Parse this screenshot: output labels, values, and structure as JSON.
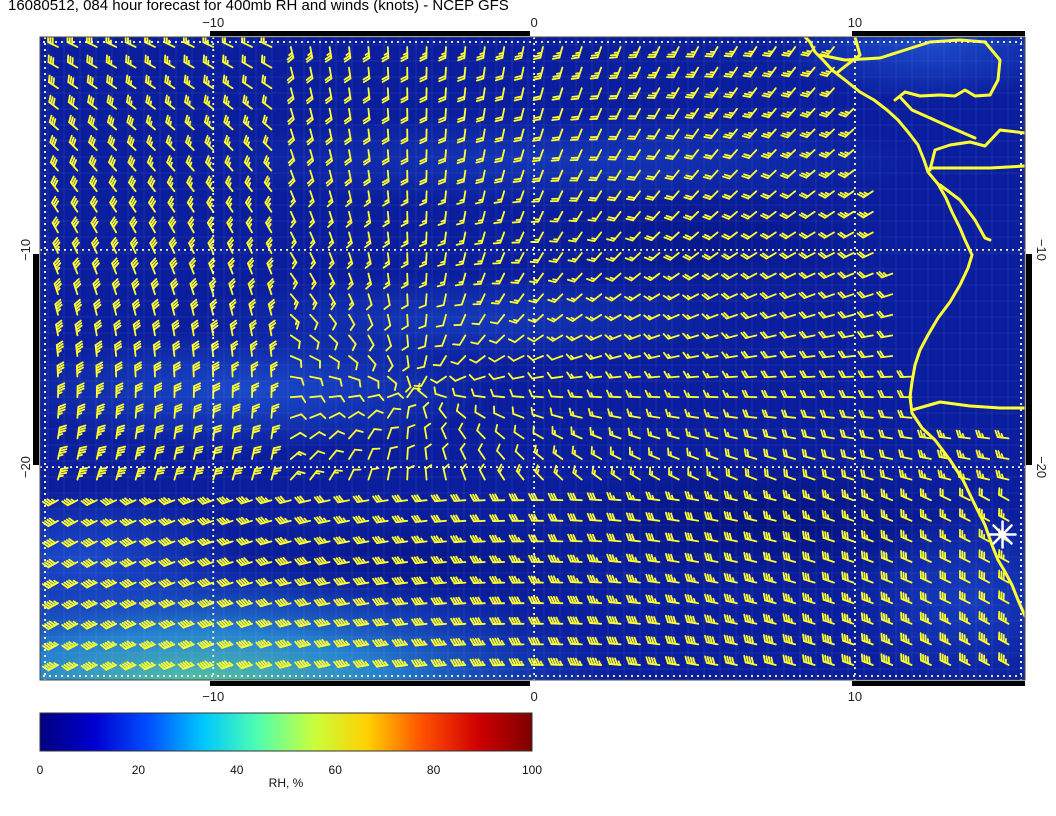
{
  "title": "16080512, 084 hour forecast for 400mb RH and winds (knots) - NCEP GFS",
  "axes": {
    "lon_ticks": [
      {
        "value": -10,
        "label": "−10"
      },
      {
        "value": 0,
        "label": "0"
      },
      {
        "value": 10,
        "label": "10"
      }
    ],
    "lat_ticks": [
      {
        "value": -10,
        "label": "−10"
      },
      {
        "value": -20,
        "label": "−20"
      }
    ],
    "lon_range": [
      -15.4,
      15.3
    ],
    "lat_range": [
      -29.8,
      -0.2
    ]
  },
  "colorbar": {
    "label": "RH, %",
    "range": [
      0,
      100
    ],
    "ticks": [
      "0",
      "20",
      "40",
      "60",
      "80",
      "100"
    ],
    "colors": [
      "#00007f",
      "#0000d0",
      "#0050ff",
      "#00c8ff",
      "#50ffb0",
      "#c8ff3c",
      "#ffd000",
      "#ff5000",
      "#d00000",
      "#7f0000"
    ]
  },
  "colors": {
    "wind_barbs": "#ffff33",
    "coastline": "#ffff33",
    "grid_lines": "#ffffcc",
    "ocean_rh_base": "#0a1fa0",
    "marker": "#ffffff"
  },
  "marker": {
    "name": "star-marker",
    "lon": 14.6,
    "lat": -23.1
  }
}
